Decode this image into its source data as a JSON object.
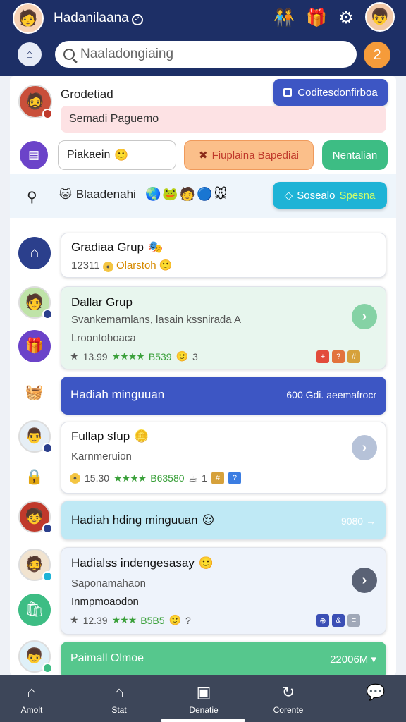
{
  "app": {
    "title": "Hadanilaana",
    "search_placeholder": "Naaladongiaing",
    "notification_count": "2"
  },
  "colors": {
    "header": "#1d2f66",
    "primary": "#3d56c4",
    "accent_orange": "#f59b3a",
    "green": "#3dbd84",
    "teal": "#1eb3d6"
  },
  "profile": {
    "name": "Grodetiad",
    "action_button": "Coditesdonfirboa",
    "status_text": "Semadi Paguemo"
  },
  "chips": {
    "white_pill": "Piakaein",
    "orange_pill": "Fiuplaina Bapediai",
    "green_pill": "Nentalian"
  },
  "band": {
    "label": "Blaadenahi",
    "emojis": "🌏🐸🧑🔵🐭",
    "button": "Sosealo",
    "button_highlight": "Spesna"
  },
  "cards": [
    {
      "title": "Gradiaa Grup",
      "sub_number": "12311",
      "sub_label": "Olarstoh"
    },
    {
      "title": "Dallar Grup",
      "desc": "Svankemarnlans, lasain kssnirada A",
      "desc2": "Lroontoboaca",
      "stat": "13.99",
      "stat_value": "B539",
      "stat_tail": "3"
    },
    {
      "title": "Hadiah minguuan",
      "value": "600 Gdi. aeemafrocr"
    },
    {
      "title": "Fullap sfup",
      "desc": "Karnmeruion",
      "stat": "15.30",
      "stat_value": "B63580",
      "stat_tail": "1"
    },
    {
      "title": "Hadiah hding minguuan",
      "value": "9080"
    },
    {
      "title": "Hadialss indengesasay",
      "desc": "Saponamahaon",
      "desc2": "Inmpmoaodon",
      "stat": "12.39",
      "stat_value": "B5B5",
      "stat_tail": "?"
    },
    {
      "title": "Paimall Olmoe",
      "value": "22006M"
    }
  ],
  "nav": [
    {
      "label": "Amolt",
      "icon": "home-icon"
    },
    {
      "label": "Stat",
      "icon": "house-icon"
    },
    {
      "label": "Denatie",
      "icon": "grid-icon"
    },
    {
      "label": "Corente",
      "icon": "refresh-icon"
    },
    {
      "label": "",
      "icon": "chat-icon"
    }
  ]
}
